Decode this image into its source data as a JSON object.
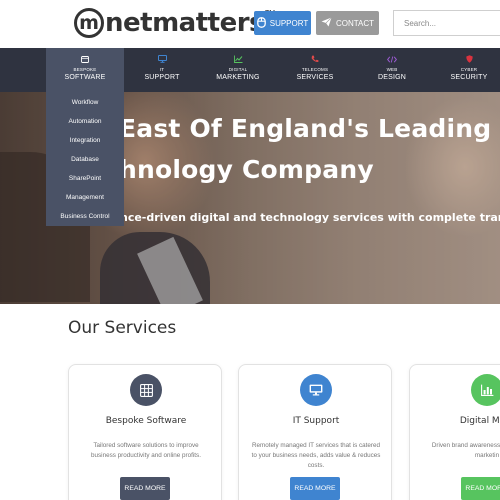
{
  "header": {
    "logo_text": "netmatters",
    "logo_tm": "TM",
    "support_label": "SUPPORT",
    "contact_label": "CONTACT",
    "search_placeholder": "Search..."
  },
  "nav": {
    "items": [
      {
        "small": "BESPOKE",
        "big": "SOFTWARE",
        "icon": "software-icon",
        "color": "#ffffff"
      },
      {
        "small": "IT",
        "big": "SUPPORT",
        "icon": "monitor-icon",
        "color": "#3f84d0"
      },
      {
        "small": "DIGITAL",
        "big": "MARKETING",
        "icon": "chart-icon",
        "color": "#57c45f"
      },
      {
        "small": "TELECOMS",
        "big": "SERVICES",
        "icon": "phone-icon",
        "color": "#e04a4a"
      },
      {
        "small": "WEB",
        "big": "DESIGN",
        "icon": "code-icon",
        "color": "#9b5bd1"
      },
      {
        "small": "CYBER",
        "big": "SECURITY",
        "icon": "shield-icon",
        "color": "#d9333f"
      }
    ],
    "dropdown": [
      "Workflow",
      "Automation",
      "Integration",
      "Database",
      "SharePoint",
      "Management",
      "Business Control"
    ]
  },
  "hero": {
    "line1": "East Of England's Leading",
    "line2": "hnology Company",
    "tagline": "nce-driven digital and technology services with complete transpare"
  },
  "services": {
    "title": "Our Services",
    "cards": [
      {
        "title": "Bespoke Software",
        "desc": "Tailored software solutions to improve business productivity and online profits.",
        "button": "READ MORE",
        "color": "#4a5266",
        "icon": "grid-icon"
      },
      {
        "title": "IT Support",
        "desc": "Remotely managed IT services that is catered to your business needs, adds value & reduces costs.",
        "button": "READ MORE",
        "color": "#3f84d0",
        "icon": "monitor-icon"
      },
      {
        "title": "Digital Mark",
        "desc": "Driven brand awareness creative digital marketin",
        "button": "READ MORE",
        "color": "#57c45f",
        "icon": "chart-icon"
      }
    ]
  }
}
